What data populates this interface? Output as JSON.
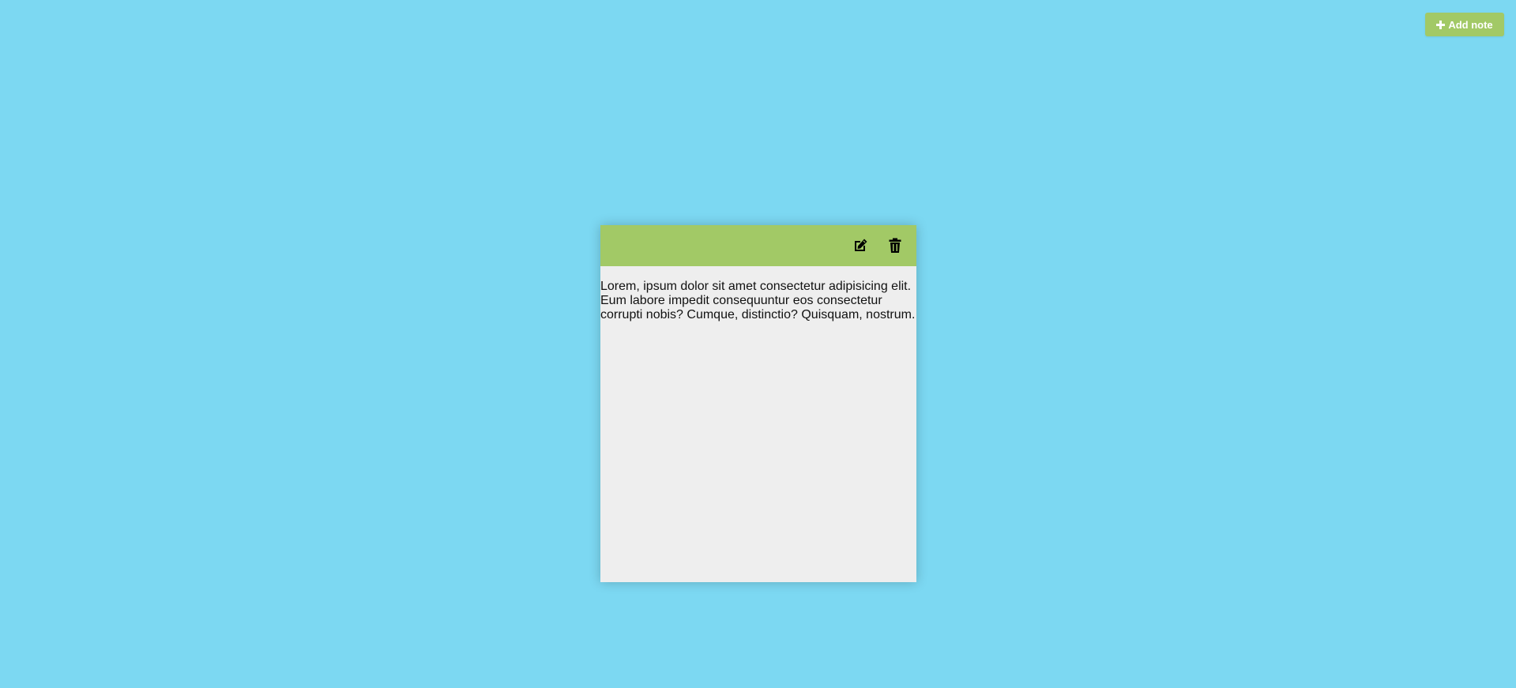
{
  "header": {
    "add_note_label": "Add note",
    "add_note_icon": "plus-icon"
  },
  "note": {
    "toolbar": {
      "edit_icon": "edit-icon",
      "delete_icon": "trash-icon"
    },
    "text": "Lorem, ipsum dolor sit amet consectetur adipisicing elit. Eum labore impedit consequuntur eos consectetur corrupti nobis? Cumque, distinctio? Quisquam, nostrum."
  },
  "colors": {
    "background": "#7cd8f2",
    "accent": "#a2c966",
    "note_body": "#eeeeee"
  }
}
